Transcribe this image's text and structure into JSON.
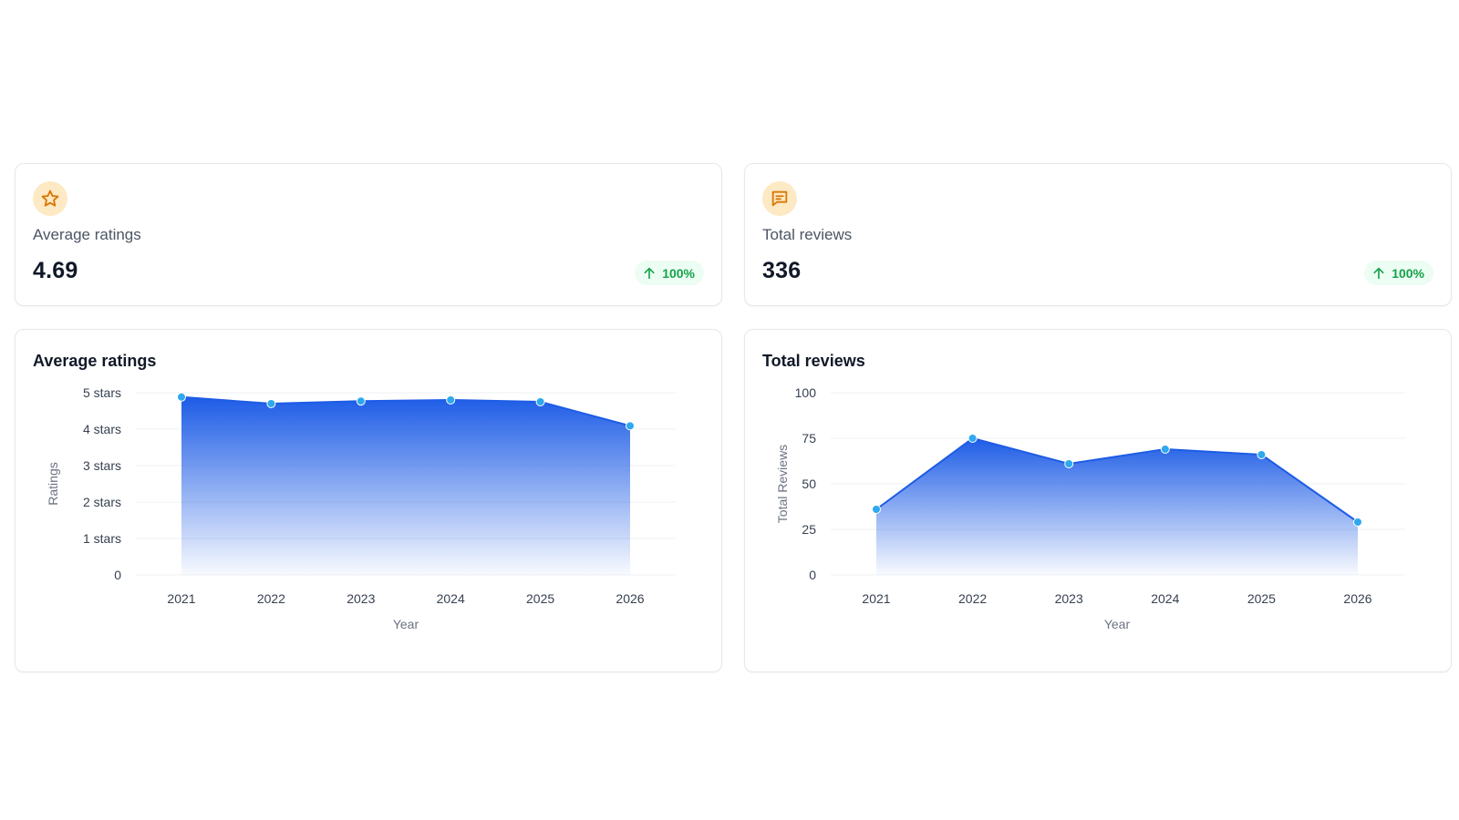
{
  "stats": [
    {
      "icon": "star-icon",
      "label": "Average ratings",
      "value": "4.69",
      "change": "100%"
    },
    {
      "icon": "message-square-icon",
      "label": "Total reviews",
      "value": "336",
      "change": "100%"
    }
  ],
  "colors": {
    "line": "#1d5ce6",
    "point": "#2ea8ee",
    "badge_text": "#16a34a",
    "icon_bg": "#fde9c4",
    "icon_stroke": "#d97706"
  },
  "charts": [
    {
      "title": "Average ratings",
      "chart_data": {
        "type": "area",
        "categories": [
          "2021",
          "2022",
          "2023",
          "2024",
          "2025",
          "2026"
        ],
        "series": [
          {
            "values": [
              4.88,
              4.7,
              4.77,
              4.8,
              4.75,
              4.09
            ]
          }
        ],
        "ylim": [
          0,
          5
        ],
        "yticks": [
          0,
          1,
          2,
          3,
          4,
          5
        ],
        "ytick_labels": [
          "0",
          "1 stars",
          "2 stars",
          "3 stars",
          "4 stars",
          "5 stars"
        ],
        "xlabel": "Year",
        "ylabel": "Ratings",
        "grid": true
      }
    },
    {
      "title": "Total reviews",
      "chart_data": {
        "type": "area",
        "categories": [
          "2021",
          "2022",
          "2023",
          "2024",
          "2025",
          "2026"
        ],
        "series": [
          {
            "values": [
              36,
              75,
              61,
              69,
              66,
              29
            ]
          }
        ],
        "ylim": [
          0,
          100
        ],
        "yticks": [
          0,
          25,
          50,
          75,
          100
        ],
        "ytick_labels": [
          "0",
          "25",
          "50",
          "75",
          "100"
        ],
        "xlabel": "Year",
        "ylabel": "Total Reviews",
        "grid": true
      }
    }
  ]
}
